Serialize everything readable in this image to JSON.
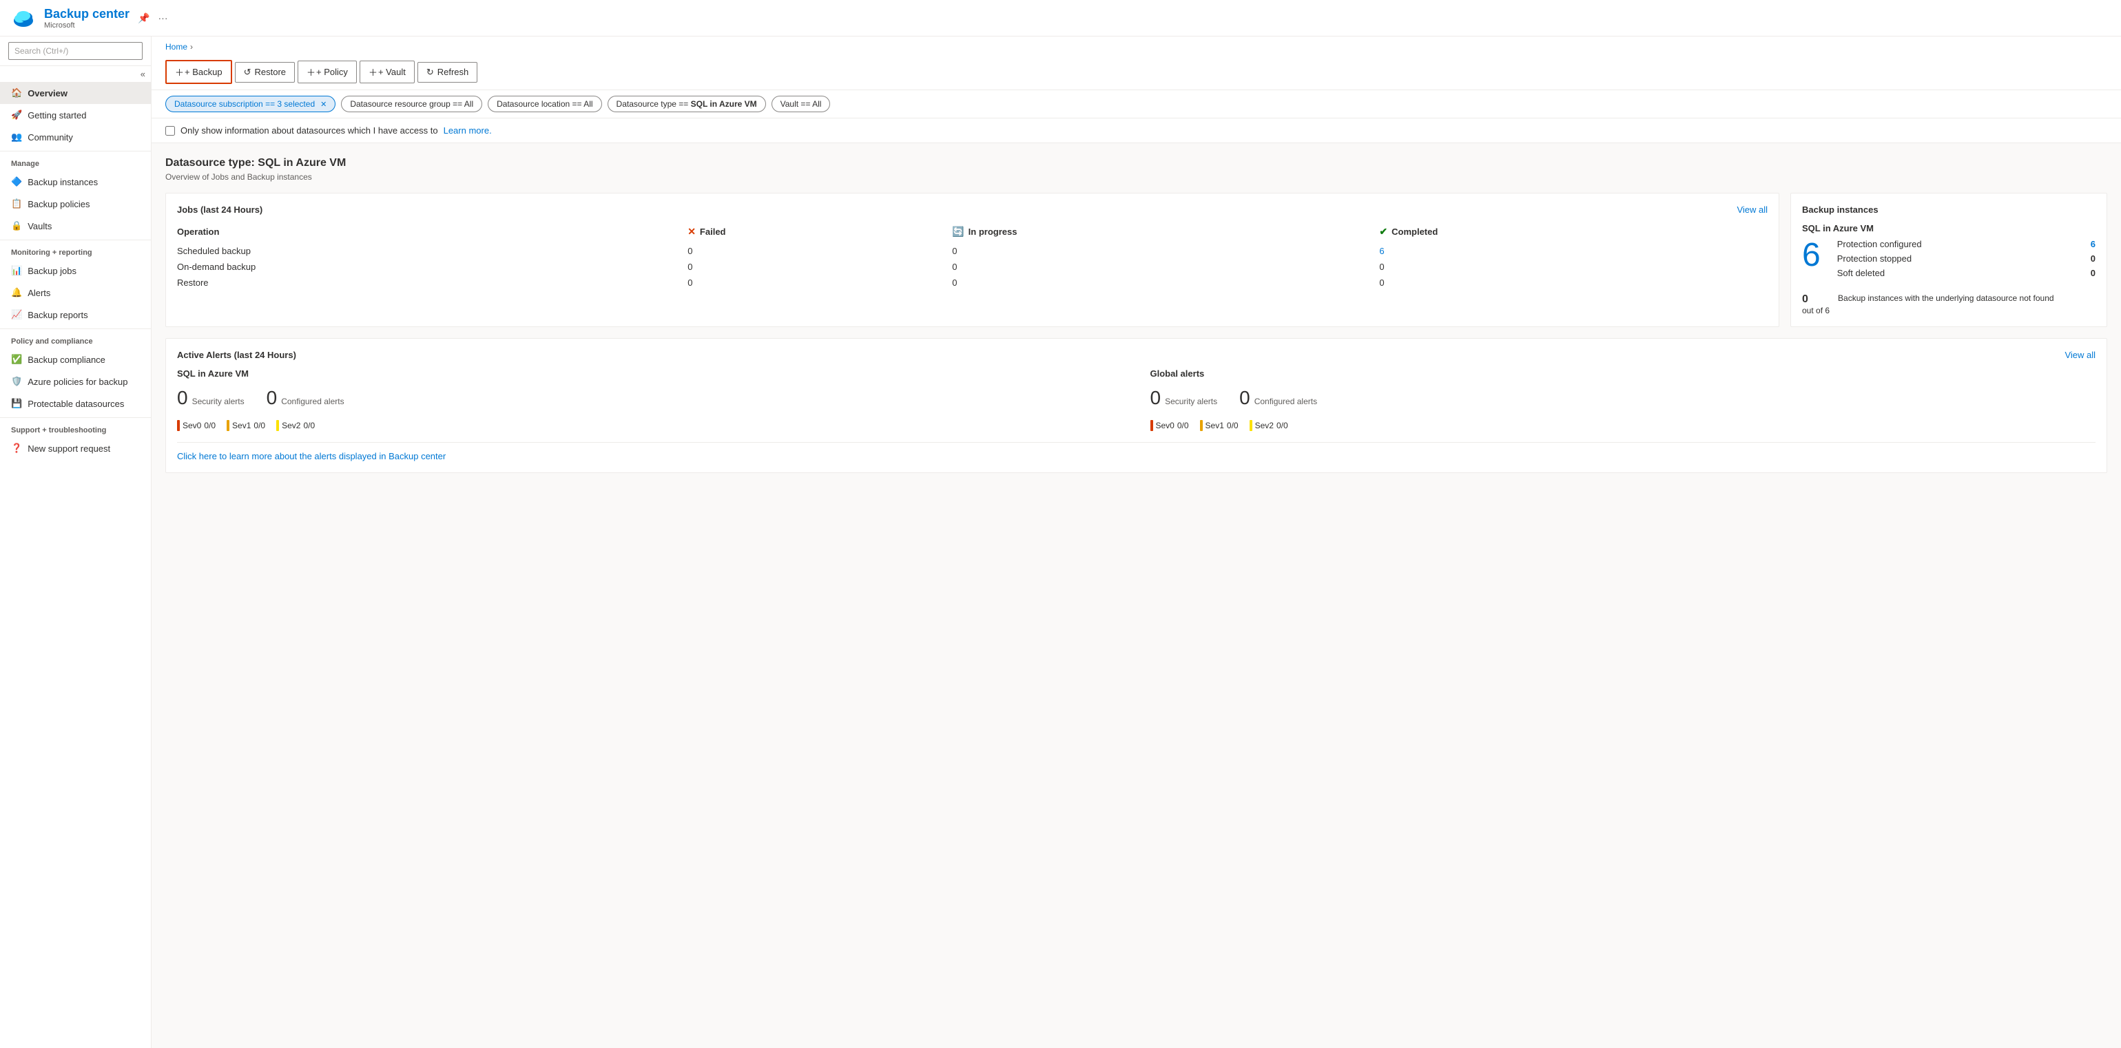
{
  "app": {
    "title": "Backup center",
    "subtitle": "Microsoft",
    "breadcrumb_home": "Home"
  },
  "toolbar": {
    "backup_label": "+ Backup",
    "restore_label": "Restore",
    "policy_label": "+ Policy",
    "vault_label": "+ Vault",
    "refresh_label": "Refresh"
  },
  "filters": [
    {
      "label": "Datasource subscription == 3 selected",
      "active": true
    },
    {
      "label": "Datasource resource group == All",
      "active": false
    },
    {
      "label": "Datasource location == All",
      "active": false
    },
    {
      "label": "Datasource type == SQL in Azure VM",
      "active": false
    },
    {
      "label": "Vault == All",
      "active": false
    }
  ],
  "checkbox": {
    "label": "Only show information about datasources which I have access to",
    "link_text": "Learn more."
  },
  "datasource": {
    "title": "Datasource type: SQL in Azure VM",
    "subtitle": "Overview of Jobs and Backup instances"
  },
  "jobs_card": {
    "title": "Jobs (last 24 Hours)",
    "view_all": "View all",
    "headers": {
      "operation": "Operation",
      "failed": "Failed",
      "in_progress": "In progress",
      "completed": "Completed"
    },
    "rows": [
      {
        "operation": "Scheduled backup",
        "failed": "0",
        "in_progress": "0",
        "completed": "6"
      },
      {
        "operation": "On-demand backup",
        "failed": "0",
        "in_progress": "0",
        "completed": "0"
      },
      {
        "operation": "Restore",
        "failed": "0",
        "in_progress": "0",
        "completed": "0"
      }
    ]
  },
  "backup_instances_card": {
    "title": "Backup instances",
    "datasource_type": "SQL in Azure VM",
    "big_number": "6",
    "stats": [
      {
        "label": "Protection configured",
        "value": "6",
        "is_link": true
      },
      {
        "label": "Protection stopped",
        "value": "0",
        "is_link": false
      },
      {
        "label": "Soft deleted",
        "value": "0",
        "is_link": false
      }
    ],
    "not_found_count": "0",
    "not_found_of": "out of 6",
    "not_found_desc": "Backup instances with the underlying datasource not found"
  },
  "alerts_card": {
    "title": "Active Alerts (last 24 Hours)",
    "view_all": "View all",
    "sections": [
      {
        "title": "SQL in Azure VM",
        "security_alerts": "0",
        "configured_alerts": "0",
        "sev": [
          {
            "label": "Sev0",
            "value": "0/0",
            "color": "#d83b01"
          },
          {
            "label": "Sev1",
            "value": "0/0",
            "color": "#e8a200"
          },
          {
            "label": "Sev2",
            "value": "0/0",
            "color": "#fce100"
          }
        ]
      },
      {
        "title": "Global alerts",
        "security_alerts": "0",
        "configured_alerts": "0",
        "sev": [
          {
            "label": "Sev0",
            "value": "0/0",
            "color": "#d83b01"
          },
          {
            "label": "Sev1",
            "value": "0/0",
            "color": "#e8a200"
          },
          {
            "label": "Sev2",
            "value": "0/0",
            "color": "#fce100"
          }
        ]
      }
    ],
    "learn_more_text": "Click here to learn more about the alerts displayed in Backup center"
  },
  "sidebar": {
    "search_placeholder": "Search (Ctrl+/)",
    "nav_items": [
      {
        "id": "overview",
        "label": "Overview",
        "active": true,
        "section": null
      },
      {
        "id": "getting-started",
        "label": "Getting started",
        "active": false,
        "section": null
      },
      {
        "id": "community",
        "label": "Community",
        "active": false,
        "section": null
      },
      {
        "id": "manage-section",
        "label": "Manage",
        "section_header": true
      },
      {
        "id": "backup-instances",
        "label": "Backup instances",
        "active": false,
        "section": "Manage"
      },
      {
        "id": "backup-policies",
        "label": "Backup policies",
        "active": false,
        "section": "Manage"
      },
      {
        "id": "vaults",
        "label": "Vaults",
        "active": false,
        "section": "Manage"
      },
      {
        "id": "monitoring-section",
        "label": "Monitoring + reporting",
        "section_header": true
      },
      {
        "id": "backup-jobs",
        "label": "Backup jobs",
        "active": false,
        "section": "Monitoring"
      },
      {
        "id": "alerts",
        "label": "Alerts",
        "active": false,
        "section": "Monitoring"
      },
      {
        "id": "backup-reports",
        "label": "Backup reports",
        "active": false,
        "section": "Monitoring"
      },
      {
        "id": "policy-section",
        "label": "Policy and compliance",
        "section_header": true
      },
      {
        "id": "backup-compliance",
        "label": "Backup compliance",
        "active": false,
        "section": "Policy"
      },
      {
        "id": "azure-policies",
        "label": "Azure policies for backup",
        "active": false,
        "section": "Policy"
      },
      {
        "id": "protectable-datasources",
        "label": "Protectable datasources",
        "active": false,
        "section": "Policy"
      },
      {
        "id": "support-section",
        "label": "Support + troubleshooting",
        "section_header": true
      },
      {
        "id": "new-support",
        "label": "New support request",
        "active": false,
        "section": "Support"
      }
    ]
  }
}
